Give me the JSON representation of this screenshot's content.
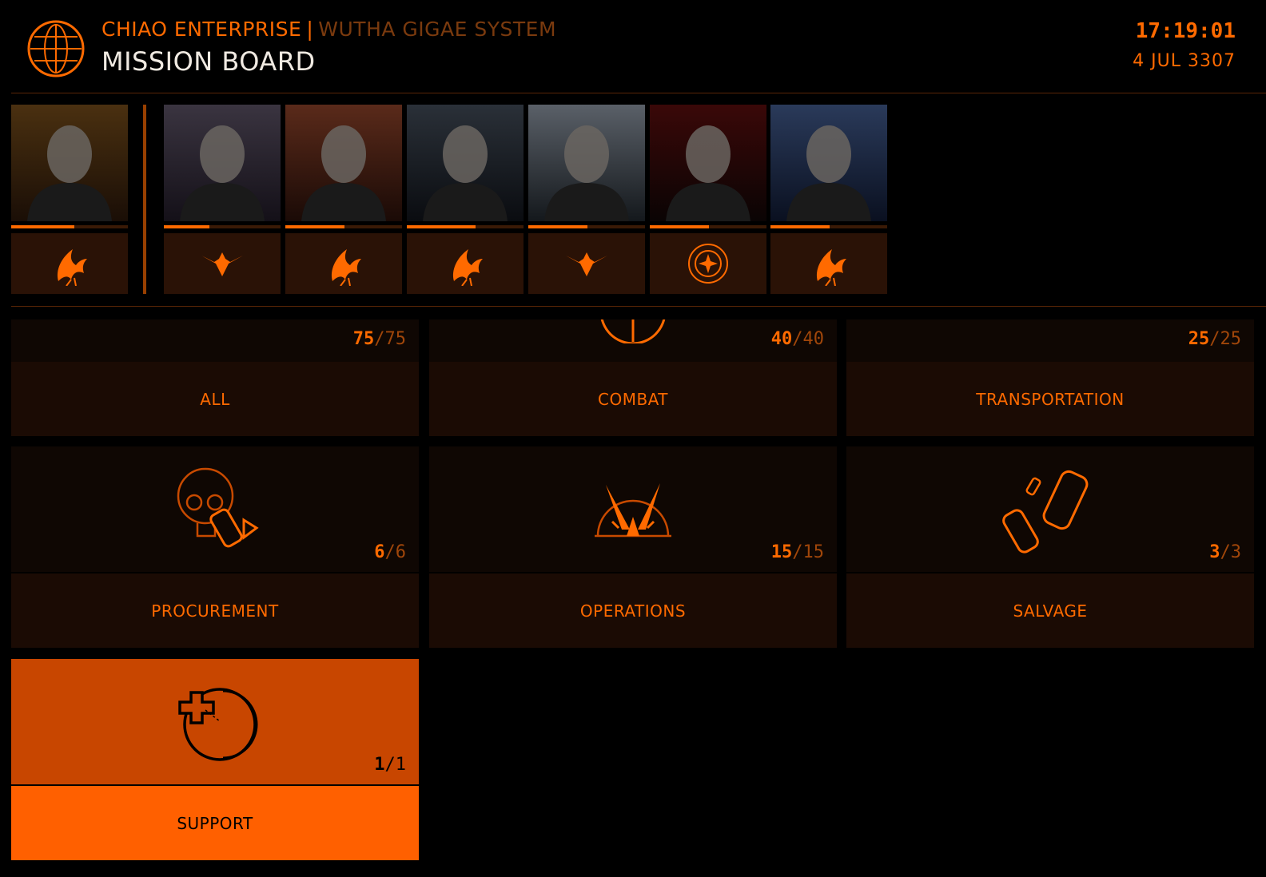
{
  "header": {
    "station_name": "CHIAO ENTERPRISE",
    "separator": "|",
    "system_name": "WUTHA GIGAE SYSTEM",
    "title": "MISSION BOARD",
    "time": "17:19:01",
    "date": "4 JUL 3307"
  },
  "contacts": [
    {
      "faction_icon": "federation-phoenix-icon",
      "reputation_pct": 54
    },
    {
      "faction_icon": "imperial-eagle-icon",
      "reputation_pct": 39
    },
    {
      "faction_icon": "federation-phoenix-icon",
      "reputation_pct": 51
    },
    {
      "faction_icon": "federation-phoenix-icon",
      "reputation_pct": 59
    },
    {
      "faction_icon": "imperial-eagle-icon",
      "reputation_pct": 51
    },
    {
      "faction_icon": "alliance-star-icon",
      "reputation_pct": 51
    },
    {
      "faction_icon": "federation-phoenix-icon",
      "reputation_pct": 51
    }
  ],
  "categories": {
    "all": {
      "label": "ALL",
      "available": "75",
      "total": "75"
    },
    "combat": {
      "label": "COMBAT",
      "available": "40",
      "total": "40"
    },
    "transportation": {
      "label": "TRANSPORTATION",
      "available": "25",
      "total": "25"
    },
    "procurement": {
      "label": "PROCUREMENT",
      "available": "6",
      "total": "6"
    },
    "operations": {
      "label": "OPERATIONS",
      "available": "15",
      "total": "15"
    },
    "salvage": {
      "label": "SALVAGE",
      "available": "3",
      "total": "3"
    },
    "support": {
      "label": "SUPPORT",
      "available": "1",
      "total": "1"
    }
  },
  "colors": {
    "accent": "#ff6a00",
    "selected": "#ff6000",
    "background": "#000000"
  }
}
